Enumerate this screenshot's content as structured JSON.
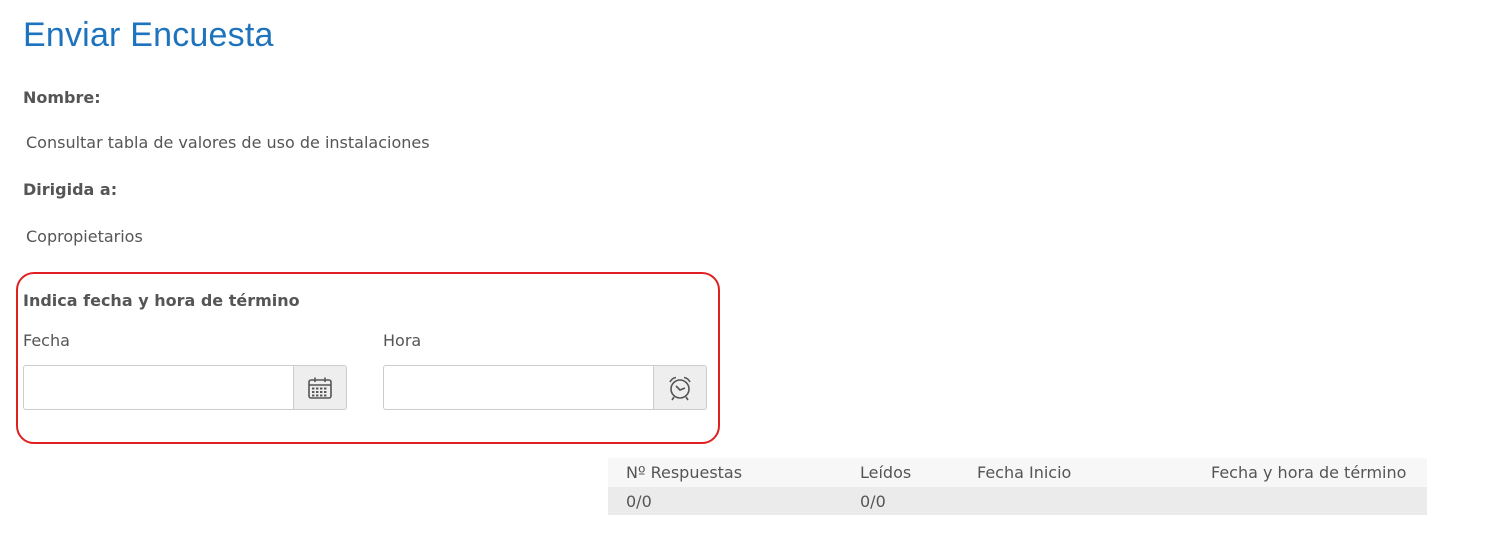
{
  "page": {
    "title": "Enviar Encuesta"
  },
  "survey": {
    "name_label": "Nombre:",
    "name_value": "Consultar tabla de valores de uso de instalaciones",
    "target_label": "Dirigida a:",
    "target_value": "Copropietarios"
  },
  "end_datetime": {
    "heading": "Indica fecha y hora de término",
    "date_label": "Fecha",
    "date_value": "",
    "time_label": "Hora",
    "time_value": "",
    "calendar_icon": "calendar-icon",
    "clock_icon": "alarm-clock-icon"
  },
  "stats": {
    "columns": [
      "Nº Respuestas",
      "Leídos",
      "Fecha Inicio",
      "Fecha y hora de término"
    ],
    "rows": [
      [
        "0/0",
        "0/0",
        "",
        ""
      ]
    ]
  },
  "colors": {
    "title": "#1e73be",
    "highlight_border": "#e02020",
    "text": "#555555"
  }
}
